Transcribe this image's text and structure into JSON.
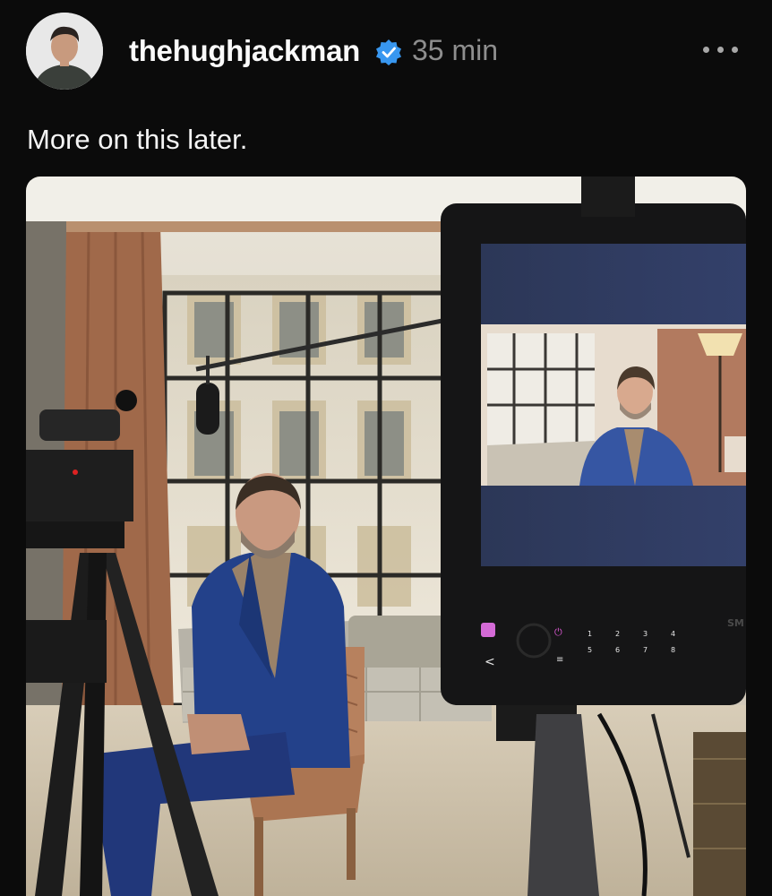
{
  "post": {
    "username": "thehughjackman",
    "verified": true,
    "time": "35 min",
    "caption": "More on this later.",
    "more_icon": "more-horizontal-icon",
    "avatar_icon": "profile-avatar",
    "verified_icon": "verified-badge-icon"
  },
  "monitor": {
    "buttons": [
      "1",
      "2",
      "3",
      "4",
      "5",
      "6",
      "7",
      "8"
    ],
    "brand_fragment": "SM"
  },
  "colors": {
    "background": "#0b0b0b",
    "username": "#fafafa",
    "timestamp": "#8e8e8e",
    "verified": "#3897f0"
  }
}
